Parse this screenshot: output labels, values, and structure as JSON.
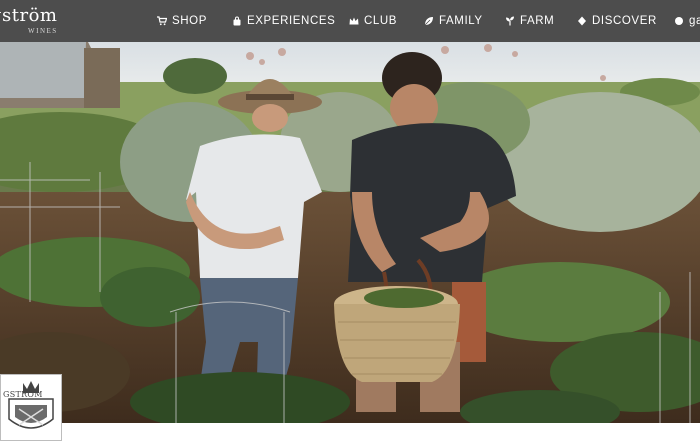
{
  "brand": {
    "name": "gström",
    "subtitle": "WINES"
  },
  "nav": {
    "items": [
      {
        "label": "SHOP",
        "icon": "cart-icon"
      },
      {
        "label": "EXPERIENCES",
        "icon": "bag-icon"
      },
      {
        "label": "CLUB",
        "icon": "crown-icon"
      },
      {
        "label": "FAMILY",
        "icon": "leaf-icon"
      },
      {
        "label": "FARM",
        "icon": "sprout-icon"
      },
      {
        "label": "DISCOVER",
        "icon": "diamond-icon"
      },
      {
        "label": "ga",
        "icon": "gift-icon"
      }
    ]
  },
  "hero": {
    "image": "photo-two-people-harvesting-in-garden-with-woven-basket"
  },
  "crest": {
    "text": "GSTRÖM"
  },
  "colors": {
    "navbar": "#4d4d4d",
    "nav_text": "#ffffff",
    "accent": "#ffffff"
  }
}
